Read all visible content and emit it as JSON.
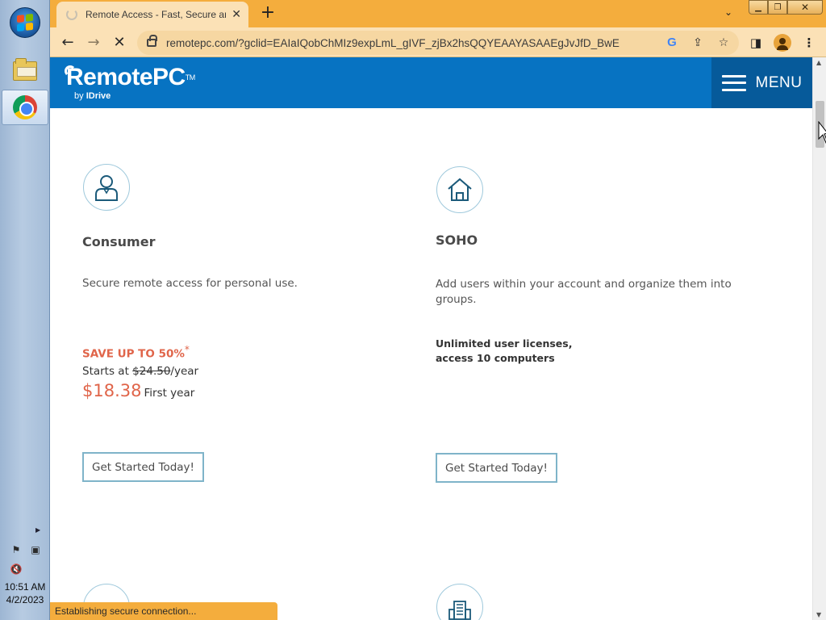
{
  "taskbar": {
    "clock_time": "10:51 AM",
    "clock_date": "4/2/2023"
  },
  "browser": {
    "tab_title": "Remote Access - Fast, Secure and",
    "url": "remotepc.com/?gclid=EAIaIQobChMIz9expLmL_gIVF_zjBx2hsQQYEAAYASAAEgJvJfD_BwE",
    "status_text": "Establishing secure connection..."
  },
  "site": {
    "brand": "RemotePC",
    "brand_tm": "TM",
    "by_text": "by",
    "by_brand": "IDrive",
    "menu_label": "MENU"
  },
  "plans": {
    "consumer": {
      "title": "Consumer",
      "description": "Secure remote access for personal use.",
      "save_text": "SAVE UP TO 50%",
      "save_mark": "*",
      "starts_prefix": "Starts at",
      "old_price": "$24.50",
      "per_year": "/year",
      "price": "$18.38",
      "price_note": "First year",
      "cta": "Get Started Today!"
    },
    "soho": {
      "title": "SOHO",
      "description": "Add users within your account and organize them into groups.",
      "licenses_line1": "Unlimited user licenses,",
      "licenses_line2": "access 10 computers",
      "cta": "Get Started Today!"
    }
  }
}
